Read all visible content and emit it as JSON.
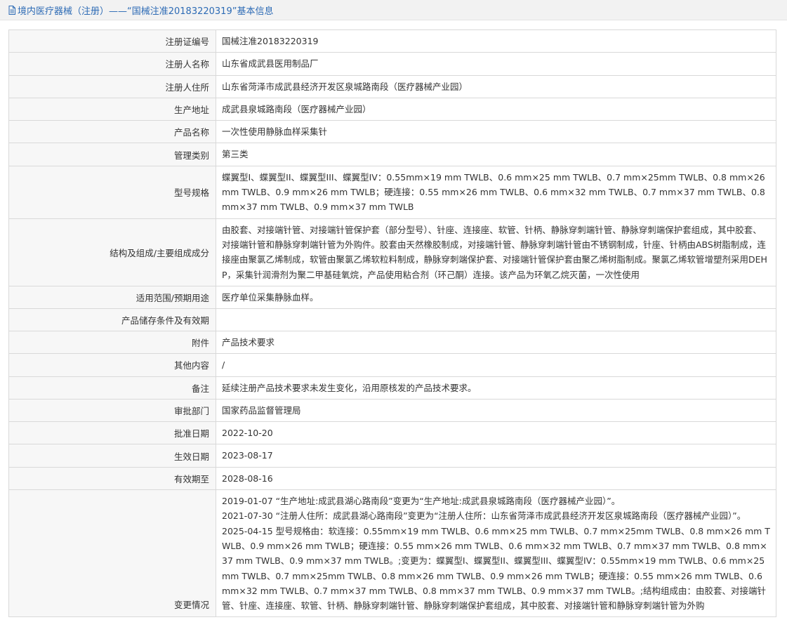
{
  "header": {
    "title": "境内医疗器械（注册）——“国械注准20183220319”基本信息"
  },
  "rows": [
    {
      "label": "注册证编号",
      "value": "国械注准20183220319"
    },
    {
      "label": "注册人名称",
      "value": "山东省成武县医用制品厂"
    },
    {
      "label": "注册人住所",
      "value": "山东省菏泽市成武县经济开发区泉城路南段（医疗器械产业园）"
    },
    {
      "label": "生产地址",
      "value": "成武县泉城路南段（医疗器械产业园）"
    },
    {
      "label": "产品名称",
      "value": "一次性使用静脉血样采集针"
    },
    {
      "label": "管理类别",
      "value": "第三类"
    },
    {
      "label": "型号规格",
      "value": "蝶翼型I、蝶翼型II、蝶翼型III、蝶翼型IV：0.55mm×19 mm TWLB、0.6 mm×25 mm TWLB、0.7 mm×25mm TWLB、0.8 mm×26 mm TWLB、0.9 mm×26 mm TWLB；硬连接：0.55 mm×26 mm TWLB、0.6 mm×32 mm TWLB、0.7 mm×37 mm TWLB、0.8 mm×37 mm TWLB、0.9 mm×37 mm TWLB"
    },
    {
      "label": "结构及组成/主要组成成分",
      "value": "由胶套、对接端针管、对接端针管保护套（部分型号）、针座、连接座、软管、针柄、静脉穿刺端针管、静脉穿刺端保护套组成，其中胶套、对接端针管和静脉穿刺端针管为外购件。胶套由天然橡胶制成，对接端针管、静脉穿刺端针管由不锈钢制成，针座、针柄由ABS树脂制成，连接座由聚氯乙烯制成，软管由聚氯乙烯软粒料制成，静脉穿刺端保护套、对接端针管保护套由聚乙烯树脂制成。聚氯乙烯软管增塑剂采用DEHP，采集针润滑剂为聚二甲基硅氧烷，产品使用粘合剂（环己酮）连接。该产品为环氧乙烷灭菌，一次性使用"
    },
    {
      "label": "适用范围/预期用途",
      "value": "医疗单位采集静脉血样。"
    },
    {
      "label": "产品储存条件及有效期",
      "value": ""
    },
    {
      "label": "附件",
      "value": "产品技术要求"
    },
    {
      "label": "其他内容",
      "value": "/"
    },
    {
      "label": "备注",
      "value": "延续注册产品技术要求未发生变化，沿用原核发的产品技术要求。"
    },
    {
      "label": "审批部门",
      "value": "国家药品监督管理局"
    },
    {
      "label": "批准日期",
      "value": "2022-10-20"
    },
    {
      "label": "生效日期",
      "value": "2023-08-17"
    },
    {
      "label": "有效期至",
      "value": "2028-08-16"
    }
  ],
  "changes": {
    "label": "变更情况",
    "entries": [
      "2019-01-07 “生产地址:成武县湖心路南段”变更为“生产地址:成武县泉城路南段（医疗器械产业园）”。",
      "2021-07-30 “注册人住所：成武县湖心路南段”变更为“注册人住所：山东省菏泽市成武县经济开发区泉城路南段（医疗器械产业园）”。",
      "2025-04-15 型号规格由：软连接：0.55mm×19 mm TWLB、0.6 mm×25 mm TWLB、0.7 mm×25mm TWLB、0.8 mm×26 mm TWLB、0.9 mm×26 mm TWLB；硬连接：0.55 mm×26 mm TWLB、0.6 mm×32 mm TWLB、0.7 mm×37 mm TWLB、0.8 mm×37 mm TWLB、0.9 mm×37 mm TWLB。;变更为：蝶翼型I、蝶翼型II、蝶翼型III、蝶翼型IV：0.55mm×19 mm TWLB、0.6 mm×25 mm TWLB、0.7 mm×25mm TWLB、0.8 mm×26 mm TWLB、0.9 mm×26 mm TWLB；硬连接：0.55 mm×26 mm TWLB、0.6 mm×32 mm TWLB、0.7 mm×37 mm TWLB、0.8 mm×37 mm TWLB、0.9 mm×37 mm TWLB。;结构组成由：由胶套、对接端针管、针座、连接座、软管、针柄、静脉穿刺端针管、静脉穿刺端保护套组成，其中胶套、对接端针管和静脉穿刺端针管为外购"
    ]
  },
  "icons": {
    "header": "document-icon"
  },
  "colors": {
    "title": "#2d6bb5",
    "label_bg": "#f7f7f7",
    "border": "#d9d9d9",
    "header_bg": "#f2f2f2"
  }
}
